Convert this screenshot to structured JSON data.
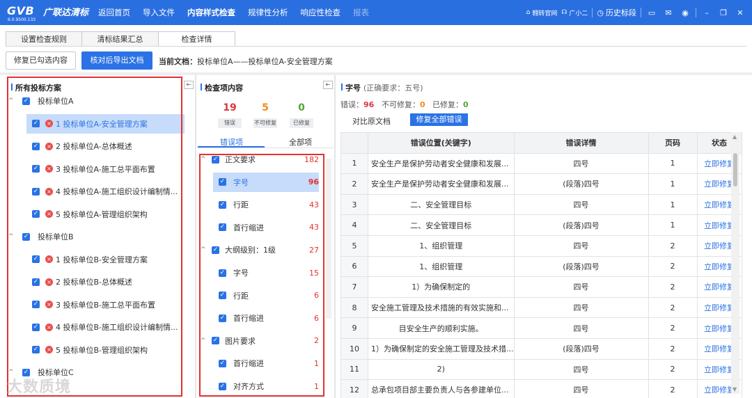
{
  "app": {
    "logo": "GVB",
    "name": "广联达清标",
    "version": "6.0.9500.133"
  },
  "nav": [
    "返回首页",
    "导入文件",
    "内容样式检查",
    "规律性分析",
    "响应性检查",
    "报表"
  ],
  "top_right": {
    "official": "翱转官网",
    "assistant": "广小二",
    "history": "历史标段"
  },
  "tabs": [
    "设置检查规则",
    "清标结果汇总",
    "检查详情"
  ],
  "actions": {
    "fix_selected": "修复已勾选内容",
    "export": "核对后导出文档",
    "current_doc_label": "当前文档：",
    "current_doc": "投标单位A——投标单位A-安全管理方案"
  },
  "left": {
    "title": "所有投标方案",
    "tree": [
      {
        "type": "group",
        "label": "投标单位A"
      },
      {
        "type": "doc",
        "label": "1 投标单位A-安全管理方案",
        "selected": true
      },
      {
        "type": "doc",
        "label": "2 投标单位A-总体概述"
      },
      {
        "type": "doc",
        "label": "3 投标单位A-施工总平面布置"
      },
      {
        "type": "doc",
        "label": "4 投标单位A-施工组织设计编制情..."
      },
      {
        "type": "doc",
        "label": "5 投标单位A-管理组织架构"
      },
      {
        "type": "group",
        "label": "投标单位B"
      },
      {
        "type": "doc",
        "label": "1 投标单位B-安全管理方案"
      },
      {
        "type": "doc",
        "label": "2 投标单位B-总体概述"
      },
      {
        "type": "doc",
        "label": "3 投标单位B-施工总平面布置"
      },
      {
        "type": "doc",
        "label": "4 投标单位B-施工组织设计编制情..."
      },
      {
        "type": "doc",
        "label": "5 投标单位B-管理组织架构"
      },
      {
        "type": "group",
        "label": "投标单位C"
      }
    ]
  },
  "middle": {
    "title": "检查项内容",
    "stats": [
      {
        "num": "19",
        "label": "错误",
        "color": "#d9363e"
      },
      {
        "num": "5",
        "label": "不可修复",
        "color": "#f08c1a"
      },
      {
        "num": "0",
        "label": "已修复",
        "color": "#52a832"
      }
    ],
    "subtabs": [
      "错误项",
      "全部项"
    ],
    "items": [
      {
        "level": 0,
        "label": "正文要求",
        "count": "182"
      },
      {
        "level": 1,
        "label": "字号",
        "count": "96",
        "selected": true
      },
      {
        "level": 1,
        "label": "行距",
        "count": "43"
      },
      {
        "level": 1,
        "label": "首行缩进",
        "count": "43"
      },
      {
        "level": 0,
        "label": "大纲级别：1级",
        "count": "27"
      },
      {
        "level": 1,
        "label": "字号",
        "count": "15"
      },
      {
        "level": 1,
        "label": "行距",
        "count": "6"
      },
      {
        "level": 1,
        "label": "首行缩进",
        "count": "6"
      },
      {
        "level": 0,
        "label": "图片要求",
        "count": "2"
      },
      {
        "level": 1,
        "label": "首行缩进",
        "count": "1"
      },
      {
        "level": 1,
        "label": "对齐方式",
        "count": "1"
      }
    ]
  },
  "detail": {
    "title": "字号",
    "requirement": "(正确要求：五号)",
    "err_label": "错误：",
    "err": "96",
    "unfix_label": "不可修复：",
    "unfix": "0",
    "fixed_label": "已修复：",
    "fixed": "0",
    "compare_btn": "对比原文档",
    "fix_all_btn": "修复全部错误",
    "columns": [
      "",
      "错误位置(关键字)",
      "错误详情",
      "页码",
      "状态"
    ],
    "rows": [
      [
        "1",
        "安全生产是保护劳动者安全健康和发展...",
        "四号",
        "1",
        "立即修复"
      ],
      [
        "2",
        "安全生产是保护劳动者安全健康和发展...",
        "(段落)四号",
        "1",
        "立即修复"
      ],
      [
        "3",
        "二、安全管理目标",
        "四号",
        "1",
        "立即修复"
      ],
      [
        "4",
        "二、安全管理目标",
        "(段落)四号",
        "1",
        "立即修复"
      ],
      [
        "5",
        "1、组织管理",
        "四号",
        "2",
        "立即修复"
      ],
      [
        "6",
        "1、组织管理",
        "(段落)四号",
        "2",
        "立即修复"
      ],
      [
        "7",
        "1）为确保制定的",
        "四号",
        "2",
        "立即修复"
      ],
      [
        "8",
        "安全施工管理及技术措施的有效实施和...",
        "四号",
        "2",
        "立即修复"
      ],
      [
        "9",
        "目安全生产的顺利实施。",
        "四号",
        "2",
        "立即修复"
      ],
      [
        "10",
        "1）为确保制定的安全施工管理及技术措...",
        "(段落)四号",
        "2",
        "立即修复"
      ],
      [
        "11",
        "2)",
        "四号",
        "2",
        "立即修复"
      ],
      [
        "12",
        "总承包项目部主要负责人与各参建单位...",
        "四号",
        "2",
        "立即修复"
      ]
    ]
  },
  "watermark": "大数质境"
}
